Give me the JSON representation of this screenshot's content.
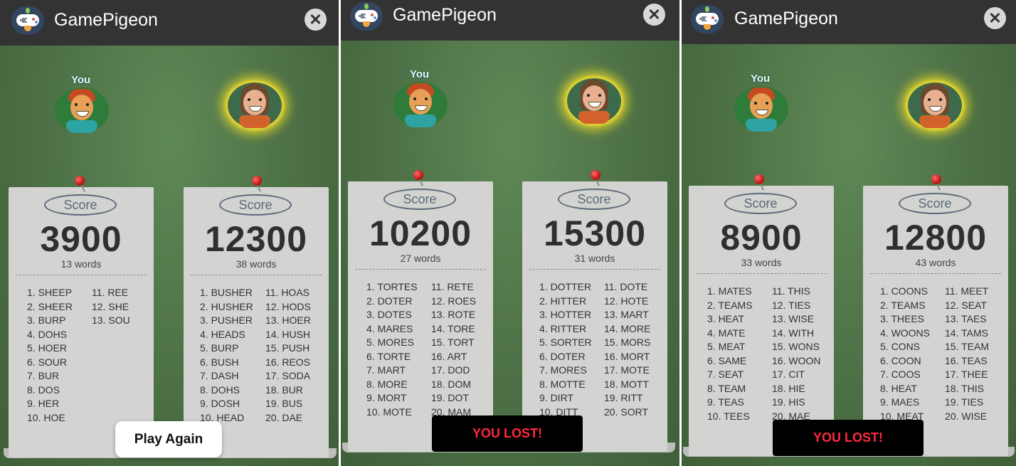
{
  "app": {
    "title": "GamePigeon",
    "close_glyph": "✕"
  },
  "colors": {
    "board": "#4f7247",
    "topbar": "#333333",
    "lost_text": "#ff2a3d",
    "glow": "#f0e04a"
  },
  "panels": [
    {
      "you_label": "You",
      "action": {
        "type": "button",
        "label": "Play Again"
      },
      "players": [
        {
          "score_label": "Score",
          "score": "3900",
          "words_count": "13 words",
          "col1": [
            "1. SHEEP",
            "2. SHEER",
            "3. BURP",
            "4. DOHS",
            "5. HOER",
            "6. SOUR",
            "7. BUR",
            "8. DOS",
            "9. HER",
            "10. HOE"
          ],
          "col2": [
            "11. REE",
            "12. SHE",
            "13. SOU"
          ]
        },
        {
          "score_label": "Score",
          "score": "12300",
          "words_count": "38 words",
          "col1": [
            "1. BUSHER",
            "2. HUSHER",
            "3. PUSHER",
            "4. HEADS",
            "5. BURP",
            "6. BUSH",
            "7. DASH",
            "8. DOHS",
            "9. DOSH",
            "10. HEAD"
          ],
          "col2": [
            "11. HOAS",
            "12. HODS",
            "13. HOER",
            "14. HUSH",
            "15. PUSH",
            "16. REOS",
            "17. SODA",
            "18. BUR",
            "19. BUS",
            "20. DAE"
          ]
        }
      ]
    },
    {
      "you_label": "You",
      "action": {
        "type": "banner",
        "label": "YOU LOST!"
      },
      "players": [
        {
          "score_label": "Score",
          "score": "10200",
          "words_count": "27 words",
          "col1": [
            "1. TORTES",
            "2. DOTER",
            "3. DOTES",
            "4. MARES",
            "5. MORES",
            "6. TORTE",
            "7. MART",
            "8. MORE",
            "9. MORT",
            "10. MOTE"
          ],
          "col2": [
            "11. RETE",
            "12. ROES",
            "13. ROTE",
            "14. TORE",
            "15. TORT",
            "16. ART",
            "17. DOD",
            "18. DOM",
            "19. DOT",
            "20. MAM"
          ]
        },
        {
          "score_label": "Score",
          "score": "15300",
          "words_count": "31 words",
          "col1": [
            "1. DOTTER",
            "2. HITTER",
            "3. HOTTER",
            "4. RITTER",
            "5. SORTER",
            "6. DOTER",
            "7. MORES",
            "8. MOTTE",
            "9. DIRT",
            "10. DITT"
          ],
          "col2": [
            "11. DOTE",
            "12. HOTE",
            "13. MART",
            "14. MORE",
            "15. MORS",
            "16. MORT",
            "17. MOTE",
            "18. MOTT",
            "19. RITT",
            "20. SORT"
          ]
        }
      ]
    },
    {
      "you_label": "You",
      "action": {
        "type": "banner",
        "label": "YOU LOST!"
      },
      "players": [
        {
          "score_label": "Score",
          "score": "8900",
          "words_count": "33 words",
          "col1": [
            "1. MATES",
            "2. TEAMS",
            "3. HEAT",
            "4. MATE",
            "5. MEAT",
            "6. SAME",
            "7. SEAT",
            "8. TEAM",
            "9. TEAS",
            "10. TEES"
          ],
          "col2": [
            "11. THIS",
            "12. TIES",
            "13. WISE",
            "14. WITH",
            "15. WONS",
            "16. WOON",
            "17. CIT",
            "18. HIE",
            "19. HIS",
            "20. MAE"
          ]
        },
        {
          "score_label": "Score",
          "score": "12800",
          "words_count": "43 words",
          "col1": [
            "1. COONS",
            "2. TEAMS",
            "3. THEES",
            "4. WOONS",
            "5. CONS",
            "6. COON",
            "7. COOS",
            "8. HEAT",
            "9. MAES",
            "10. MEAT"
          ],
          "col2": [
            "11. MEET",
            "12. SEAT",
            "13. TAES",
            "14. TAMS",
            "15. TEAM",
            "16. TEAS",
            "17. THEE",
            "18. THIS",
            "19. TIES",
            "20. WISE"
          ]
        }
      ]
    }
  ]
}
